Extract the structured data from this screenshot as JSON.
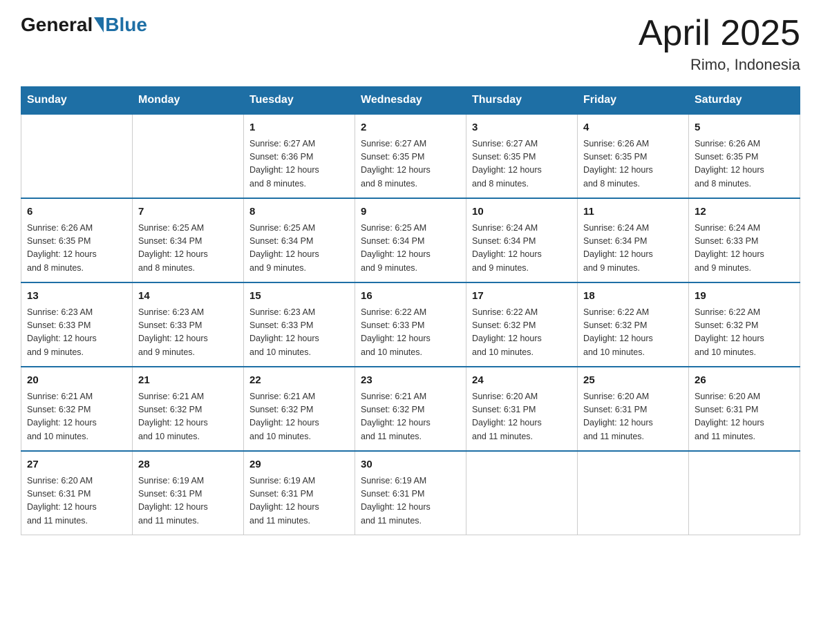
{
  "logo": {
    "general": "General",
    "blue": "Blue"
  },
  "title": "April 2025",
  "subtitle": "Rimo, Indonesia",
  "days_header": [
    "Sunday",
    "Monday",
    "Tuesday",
    "Wednesday",
    "Thursday",
    "Friday",
    "Saturday"
  ],
  "weeks": [
    [
      {
        "day": "",
        "info": ""
      },
      {
        "day": "",
        "info": ""
      },
      {
        "day": "1",
        "info": "Sunrise: 6:27 AM\nSunset: 6:36 PM\nDaylight: 12 hours\nand 8 minutes."
      },
      {
        "day": "2",
        "info": "Sunrise: 6:27 AM\nSunset: 6:35 PM\nDaylight: 12 hours\nand 8 minutes."
      },
      {
        "day": "3",
        "info": "Sunrise: 6:27 AM\nSunset: 6:35 PM\nDaylight: 12 hours\nand 8 minutes."
      },
      {
        "day": "4",
        "info": "Sunrise: 6:26 AM\nSunset: 6:35 PM\nDaylight: 12 hours\nand 8 minutes."
      },
      {
        "day": "5",
        "info": "Sunrise: 6:26 AM\nSunset: 6:35 PM\nDaylight: 12 hours\nand 8 minutes."
      }
    ],
    [
      {
        "day": "6",
        "info": "Sunrise: 6:26 AM\nSunset: 6:35 PM\nDaylight: 12 hours\nand 8 minutes."
      },
      {
        "day": "7",
        "info": "Sunrise: 6:25 AM\nSunset: 6:34 PM\nDaylight: 12 hours\nand 8 minutes."
      },
      {
        "day": "8",
        "info": "Sunrise: 6:25 AM\nSunset: 6:34 PM\nDaylight: 12 hours\nand 9 minutes."
      },
      {
        "day": "9",
        "info": "Sunrise: 6:25 AM\nSunset: 6:34 PM\nDaylight: 12 hours\nand 9 minutes."
      },
      {
        "day": "10",
        "info": "Sunrise: 6:24 AM\nSunset: 6:34 PM\nDaylight: 12 hours\nand 9 minutes."
      },
      {
        "day": "11",
        "info": "Sunrise: 6:24 AM\nSunset: 6:34 PM\nDaylight: 12 hours\nand 9 minutes."
      },
      {
        "day": "12",
        "info": "Sunrise: 6:24 AM\nSunset: 6:33 PM\nDaylight: 12 hours\nand 9 minutes."
      }
    ],
    [
      {
        "day": "13",
        "info": "Sunrise: 6:23 AM\nSunset: 6:33 PM\nDaylight: 12 hours\nand 9 minutes."
      },
      {
        "day": "14",
        "info": "Sunrise: 6:23 AM\nSunset: 6:33 PM\nDaylight: 12 hours\nand 9 minutes."
      },
      {
        "day": "15",
        "info": "Sunrise: 6:23 AM\nSunset: 6:33 PM\nDaylight: 12 hours\nand 10 minutes."
      },
      {
        "day": "16",
        "info": "Sunrise: 6:22 AM\nSunset: 6:33 PM\nDaylight: 12 hours\nand 10 minutes."
      },
      {
        "day": "17",
        "info": "Sunrise: 6:22 AM\nSunset: 6:32 PM\nDaylight: 12 hours\nand 10 minutes."
      },
      {
        "day": "18",
        "info": "Sunrise: 6:22 AM\nSunset: 6:32 PM\nDaylight: 12 hours\nand 10 minutes."
      },
      {
        "day": "19",
        "info": "Sunrise: 6:22 AM\nSunset: 6:32 PM\nDaylight: 12 hours\nand 10 minutes."
      }
    ],
    [
      {
        "day": "20",
        "info": "Sunrise: 6:21 AM\nSunset: 6:32 PM\nDaylight: 12 hours\nand 10 minutes."
      },
      {
        "day": "21",
        "info": "Sunrise: 6:21 AM\nSunset: 6:32 PM\nDaylight: 12 hours\nand 10 minutes."
      },
      {
        "day": "22",
        "info": "Sunrise: 6:21 AM\nSunset: 6:32 PM\nDaylight: 12 hours\nand 10 minutes."
      },
      {
        "day": "23",
        "info": "Sunrise: 6:21 AM\nSunset: 6:32 PM\nDaylight: 12 hours\nand 11 minutes."
      },
      {
        "day": "24",
        "info": "Sunrise: 6:20 AM\nSunset: 6:31 PM\nDaylight: 12 hours\nand 11 minutes."
      },
      {
        "day": "25",
        "info": "Sunrise: 6:20 AM\nSunset: 6:31 PM\nDaylight: 12 hours\nand 11 minutes."
      },
      {
        "day": "26",
        "info": "Sunrise: 6:20 AM\nSunset: 6:31 PM\nDaylight: 12 hours\nand 11 minutes."
      }
    ],
    [
      {
        "day": "27",
        "info": "Sunrise: 6:20 AM\nSunset: 6:31 PM\nDaylight: 12 hours\nand 11 minutes."
      },
      {
        "day": "28",
        "info": "Sunrise: 6:19 AM\nSunset: 6:31 PM\nDaylight: 12 hours\nand 11 minutes."
      },
      {
        "day": "29",
        "info": "Sunrise: 6:19 AM\nSunset: 6:31 PM\nDaylight: 12 hours\nand 11 minutes."
      },
      {
        "day": "30",
        "info": "Sunrise: 6:19 AM\nSunset: 6:31 PM\nDaylight: 12 hours\nand 11 minutes."
      },
      {
        "day": "",
        "info": ""
      },
      {
        "day": "",
        "info": ""
      },
      {
        "day": "",
        "info": ""
      }
    ]
  ]
}
